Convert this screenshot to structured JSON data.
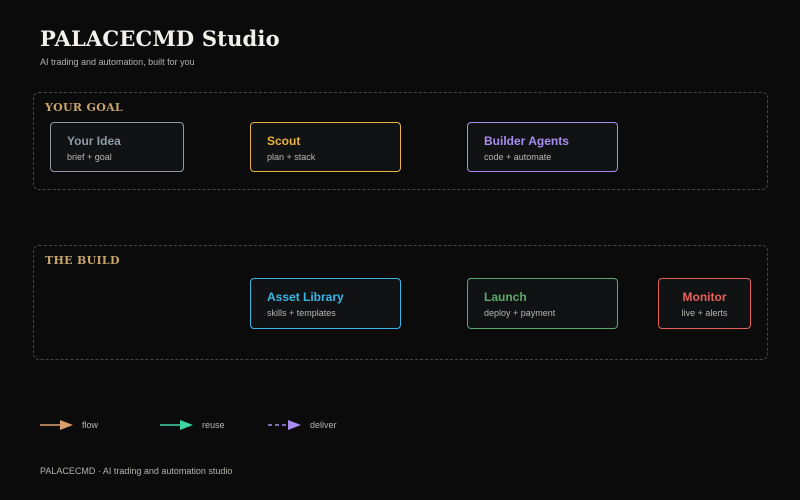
{
  "header": {
    "title": "PALACECMD Studio",
    "subtitle": "AI trading and automation, built for you"
  },
  "lanes": {
    "goal": {
      "label": "YOUR GOAL",
      "nodes": [
        {
          "title": "Your Idea",
          "sub": "brief + goal",
          "color": "#8e9aa8"
        },
        {
          "title": "Scout",
          "sub": "plan + stack",
          "color": "#e8b142"
        },
        {
          "title": "Builder Agents",
          "sub": "code + automate",
          "color": "#a98cf0"
        }
      ]
    },
    "build": {
      "label": "THE BUILD",
      "nodes": [
        {
          "title": "Asset Library",
          "sub": "skills + templates",
          "color": "#38b6e6"
        },
        {
          "title": "Launch",
          "sub": "deploy + payment",
          "color": "#5ca86a"
        },
        {
          "title": "Monitor",
          "sub": "live + alerts",
          "color": "#e8605a"
        }
      ]
    }
  },
  "legend": [
    {
      "label": "flow",
      "color": "#d9a06a",
      "style": "solid"
    },
    {
      "label": "reuse",
      "color": "#3ed6a8",
      "style": "solid"
    },
    {
      "label": "deliver",
      "color": "#a98cf0",
      "style": "dashed"
    }
  ],
  "footer": "PALACECMD · AI trading and automation studio"
}
